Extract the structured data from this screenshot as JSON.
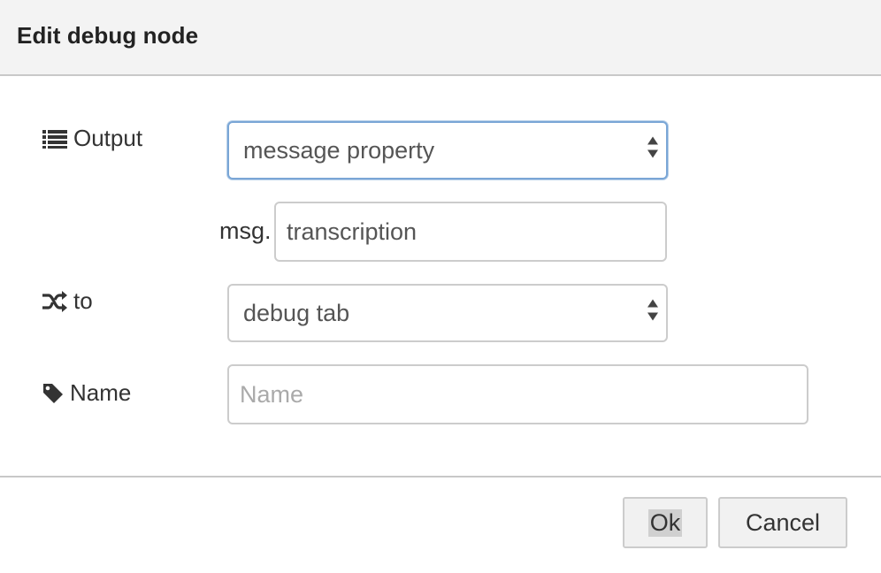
{
  "dialog": {
    "title": "Edit debug node"
  },
  "form": {
    "output": {
      "label": "Output",
      "icon": "list-icon",
      "selected": "message property"
    },
    "property": {
      "prefix": "msg.",
      "value": "transcription"
    },
    "to": {
      "label": "to",
      "icon": "random-icon",
      "selected": "debug tab"
    },
    "name": {
      "label": "Name",
      "icon": "tag-icon",
      "value": "",
      "placeholder": "Name"
    }
  },
  "footer": {
    "ok_label": "Ok",
    "cancel_label": "Cancel"
  },
  "colors": {
    "focus_border": "#7aa6d6",
    "titlebar_bg": "#f3f3f3",
    "button_bg": "#f1f1f1"
  }
}
